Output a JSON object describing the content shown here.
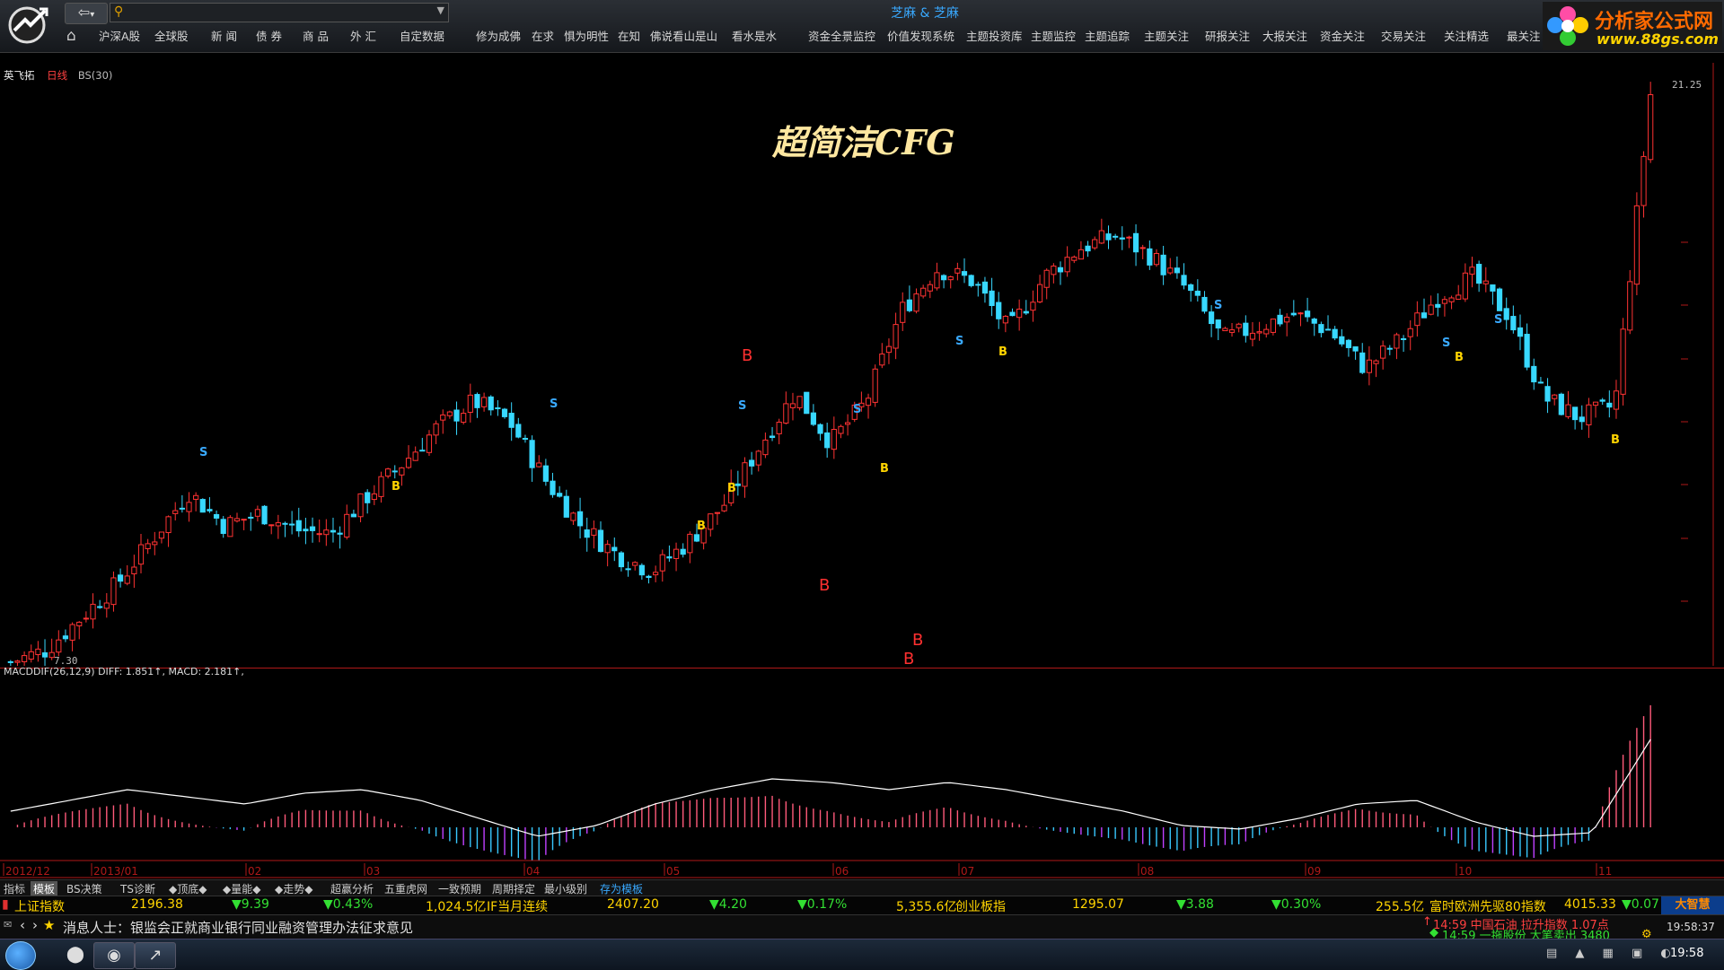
{
  "topbar": {
    "window_title": "芝麻 & 芝麻",
    "search_placeholder": "",
    "menu": [
      "沪深A股",
      "全球股",
      "新 闻",
      "债 券",
      "商 品",
      "外 汇",
      "自定数据",
      "修为成佛",
      "在求",
      "惧为明性",
      "在知",
      "佛说看山是山",
      "看水是水",
      "资金全景监控",
      "价值发现系统",
      "主题投资库",
      "主题监控",
      "主题追踪",
      "主题关注",
      "研报关注",
      "大报关注",
      "资金关注",
      "交易关注",
      "关注精选",
      "最关注"
    ],
    "brand_cn": "分析家公式网",
    "brand_url": "www.88gs.com"
  },
  "chart": {
    "stock_name": "英飞拓",
    "period": "日线",
    "indicator": "BS(30)",
    "overlay_title": "超简洁CFG",
    "price_high_label": "21.25",
    "price_low_label": "7.30",
    "macd_header": "MACDDIF(26,12,9)  DIFF: 1.851↑, MACD: 2.181↑,",
    "x_axis_labels": [
      "2012/12",
      "2013/01",
      "02",
      "03",
      "04",
      "05",
      "06",
      "07",
      "08",
      "09",
      "10",
      "11"
    ],
    "bs_labels": {
      "s": "S",
      "b": "B"
    }
  },
  "chart_data": {
    "type": "candlestick",
    "title": "超简洁CFG",
    "x_labels": [
      "2012/12",
      "2013/01",
      "02",
      "03",
      "04",
      "05",
      "06",
      "07",
      "08",
      "09",
      "10",
      "11"
    ],
    "y_range_labeled": [
      7.3,
      21.25
    ],
    "close_trend": [
      7.3,
      7.6,
      8.4,
      9.2,
      10.3,
      11.4,
      10.6,
      10.9,
      10.5,
      10.4,
      11.3,
      12.1,
      13.0,
      13.6,
      13.1,
      11.7,
      10.6,
      9.9,
      9.5,
      10.2,
      11.1,
      12.5,
      13.8,
      12.6,
      13.6,
      15.8,
      16.8,
      16.5,
      15.3,
      16.6,
      17.3,
      17.6,
      17.1,
      16.3,
      15.1,
      15.4,
      15.7,
      15.3,
      14.4,
      15.1,
      16.1,
      16.6,
      15.7,
      13.7,
      13.2,
      13.5,
      21.0
    ],
    "signals": [
      {
        "type": "S",
        "position": "2012/12 late"
      },
      {
        "type": "B",
        "position": "2013/01 late"
      },
      {
        "type": "S",
        "position": "03 late"
      },
      {
        "type": "B",
        "position": "04 mid"
      },
      {
        "type": "S",
        "position": "04 late"
      },
      {
        "type": "B",
        "position": "05 late"
      },
      {
        "type": "S",
        "position": "06 mid"
      },
      {
        "type": "B",
        "position": "06 late"
      },
      {
        "type": "S",
        "position": "07 mid"
      },
      {
        "type": "B",
        "position": "07 late"
      },
      {
        "type": "S",
        "position": "08 mid"
      },
      {
        "type": "S",
        "position": "09 late"
      },
      {
        "type": "B",
        "position": "09 late"
      },
      {
        "type": "S",
        "position": "10 mid"
      },
      {
        "type": "B",
        "position": "11 mid"
      }
    ],
    "macd_diff_trend": [
      0.0,
      0.3,
      0.6,
      0.4,
      0.2,
      0.5,
      0.6,
      0.3,
      -0.2,
      -0.7,
      -0.4,
      0.2,
      0.6,
      0.9,
      0.8,
      0.6,
      0.8,
      0.6,
      0.3,
      0.0,
      -0.4,
      -0.5,
      -0.2,
      0.2,
      0.3,
      -0.3,
      -0.7,
      -0.6,
      2.0
    ],
    "current": {
      "diff": 1.851,
      "macd": 2.181
    }
  },
  "bottom_tabs": [
    "指标",
    "模板",
    "BS决策",
    "TS诊断",
    "◆顶底◆",
    "◆量能◆",
    "◆走势◆",
    "超赢分析",
    "五重虎网",
    "一致预期",
    "周期择定",
    "最小级别",
    "存为模板"
  ],
  "index_bar": {
    "sh_name": "上证指数",
    "sh_value": "2196.38",
    "sh_change": "▼9.39",
    "sh_pct": "▼0.43%",
    "turnover": "1,024.5亿",
    "if_label": "IF当月连续",
    "if_value": "2407.20",
    "if_change": "▼4.20",
    "if_pct": "▼0.17%",
    "cy_turnover": "5,355.6亿",
    "cy_name": "创业板指",
    "cy_value": "1295.07",
    "cy_change": "▼3.88",
    "cy_pct": "▼0.30%",
    "other_turnover": "255.5亿",
    "eu_name": "富时欧洲先驱80指数",
    "eu_value": "4015.33",
    "eu_change": "▼0.07"
  },
  "news_bar": {
    "headline": "消息人士：银监会正就商业银行同业融资管理办法征求意见",
    "alert1": "14:59 中国石油 拉升指数 1.07点",
    "alert2": "14:59 一拖股份 大笔卖出 3480",
    "clock": "19:58:37",
    "brand": "大智慧"
  },
  "taskbar": {
    "time": "19:58"
  },
  "colors": {
    "up": "#ff3333",
    "down": "#38d8ff",
    "macd_line": "#ffffff",
    "accent_red": "#b01818"
  }
}
